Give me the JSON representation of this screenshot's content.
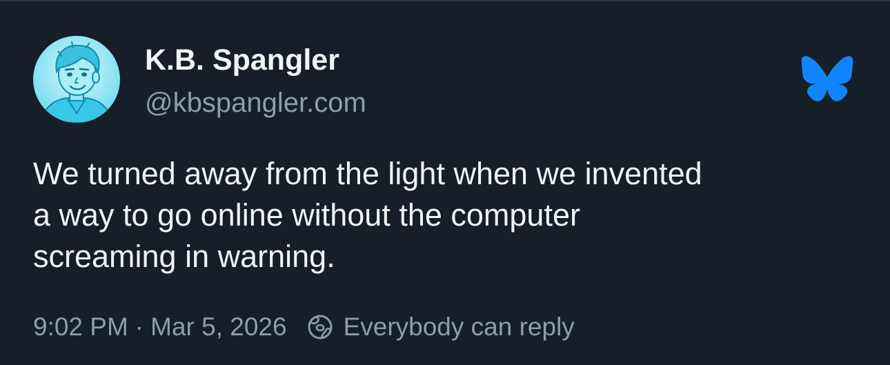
{
  "post": {
    "author": {
      "display_name": "K.B. Spangler",
      "handle": "@kbspangler.com",
      "avatar_icon": "cartoon-portrait-avatar"
    },
    "text": "We turned away from the light when we invented\na way to go online without the computer\nscreaming in warning.",
    "time": "9:02 PM",
    "separator": "·",
    "date": "Mar 5, 2026",
    "reply_setting": "Everybody can reply",
    "reply_icon": "globe-reply-icon",
    "brand_icon": "bluesky-butterfly-icon"
  },
  "colors": {
    "background": "#161e27",
    "text_primary": "#f1f3f5",
    "text_secondary": "#8f9dab",
    "brand_blue": "#1185fe",
    "avatar_cyan": "#4fd3ef"
  }
}
